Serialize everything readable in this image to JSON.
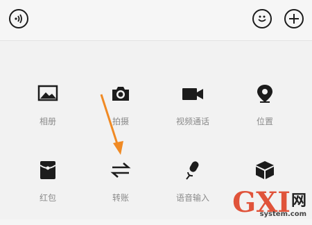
{
  "header": {
    "voice_icon": "voice-icon",
    "emoji_icon": "smile-icon",
    "plus_icon": "plus-icon"
  },
  "panel": {
    "items": [
      {
        "label": "相册",
        "icon": "photo-icon"
      },
      {
        "label": "拍摄",
        "icon": "camera-icon"
      },
      {
        "label": "视频通话",
        "icon": "video-call-icon"
      },
      {
        "label": "位置",
        "icon": "location-icon"
      },
      {
        "label": "红包",
        "icon": "red-packet-icon"
      },
      {
        "label": "转账",
        "icon": "transfer-icon"
      },
      {
        "label": "语音输入",
        "icon": "mic-icon"
      },
      {
        "label": "",
        "icon": "box-icon"
      }
    ]
  },
  "annotation": {
    "color": "#f08a24"
  },
  "watermark": {
    "main": "GXI",
    "net": "网",
    "sub": "system.com"
  }
}
